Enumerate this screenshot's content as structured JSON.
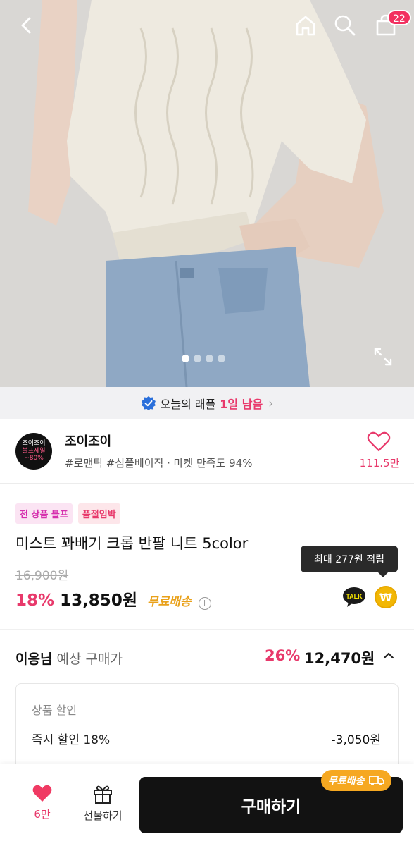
{
  "header": {
    "cart_count": "22"
  },
  "gallery": {
    "total_images": 4,
    "active_index": 0
  },
  "raffle": {
    "prefix": "오늘의 래플",
    "highlight": "1일 남음"
  },
  "seller": {
    "logo_line1": "조이조이",
    "logo_line2": "블프세일",
    "logo_line3": "~80%",
    "name": "조이조이",
    "tags": "#로맨틱 #심플베이직 · 마켓 만족도 94%",
    "fav_count": "111.5만"
  },
  "product": {
    "badges": [
      "전 상품 블프",
      "품절임박"
    ],
    "title": "미스트 꽈배기 크롭 반팔 니트 5color",
    "original_price": "16,900원",
    "discount": "18%",
    "price": "13,850원",
    "shipping": "무료배송",
    "tooltip": "최대 277원 적립",
    "talk_label": "TALK",
    "won_label": "₩"
  },
  "expected": {
    "user": "이응님",
    "label": " 예상 구매가",
    "discount": "26%",
    "price": "12,470원"
  },
  "discount_box": {
    "title": "상품 할인",
    "row_label": "즉시 할인 18%",
    "row_value": "-3,050원"
  },
  "bottom": {
    "like_count": "6만",
    "gift_label": "선물하기",
    "buy_label": "구매하기",
    "ship_pill": "무료배송"
  },
  "colors": {
    "accent": "#e8396b",
    "shipping": "#e9a11a",
    "buy": "#121212"
  }
}
